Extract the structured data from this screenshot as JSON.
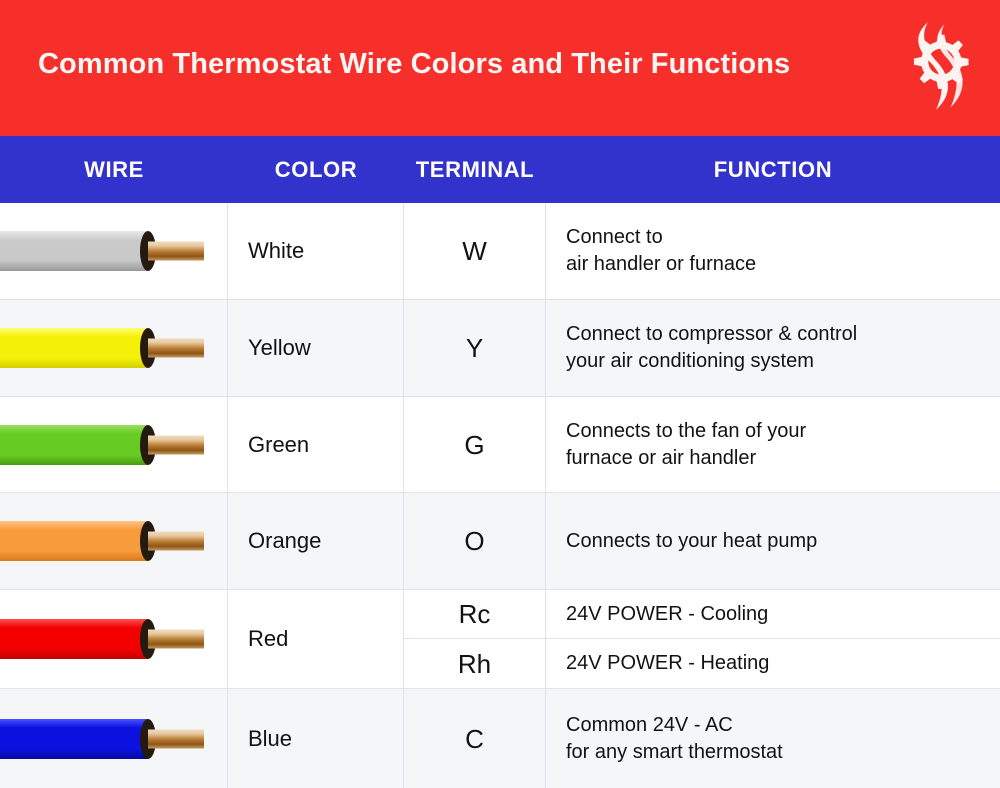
{
  "header": {
    "title": "Common Thermostat Wire Colors and Their Functions",
    "background_color": "#f72f2a",
    "title_color": "#fdf6f4",
    "logo_name": "gear-flame-logo"
  },
  "table": {
    "header_background_color": "#3232cd",
    "header_text_color": "#ffffff",
    "columns": [
      {
        "key": "wire",
        "label": "WIRE"
      },
      {
        "key": "color",
        "label": "COLOR"
      },
      {
        "key": "terminal",
        "label": "TERMINAL"
      },
      {
        "key": "function",
        "label": "FUNCTION"
      }
    ],
    "rows": [
      {
        "color": "White",
        "terminal": "W",
        "function": "Connect to\nair handler or furnace",
        "wire_color": "#c9c9c9",
        "wire_highlight": "#e8e8e8",
        "wire_shadow": "#9a9a9a",
        "row_shade": "light"
      },
      {
        "color": "Yellow",
        "terminal": "Y",
        "function": "Connect to compressor & control\nyour air conditioning system",
        "wire_color": "#f5f007",
        "wire_highlight": "#ffff7a",
        "wire_shadow": "#d4cf00",
        "row_shade": "shade"
      },
      {
        "color": "Green",
        "terminal": "G",
        "function": "Connects to the fan of your\nfurnace or air handler",
        "wire_color": "#67cc22",
        "wire_highlight": "#9ae060",
        "wire_shadow": "#4a9c13",
        "row_shade": "light"
      },
      {
        "color": "Orange",
        "terminal": "O",
        "function": "Connects to your heat pump",
        "wire_color": "#f89b3c",
        "wire_highlight": "#ffc484",
        "wire_shadow": "#d87a1a",
        "row_shade": "shade"
      },
      {
        "color": "Red",
        "terminal": "Rc",
        "terminal_2": "Rh",
        "function": "24V POWER - Cooling",
        "function_2": "24V POWER - Heating",
        "split": true,
        "wire_color": "#f40000",
        "wire_highlight": "#ff5252",
        "wire_shadow": "#c20000",
        "row_shade": "light"
      },
      {
        "color": "Blue",
        "terminal": "C",
        "function": "Common 24V - AC\nfor any smart thermostat",
        "wire_color": "#0b12e0",
        "wire_highlight": "#4a52ff",
        "wire_shadow": "#060a9c",
        "row_shade": "shade"
      }
    ]
  }
}
